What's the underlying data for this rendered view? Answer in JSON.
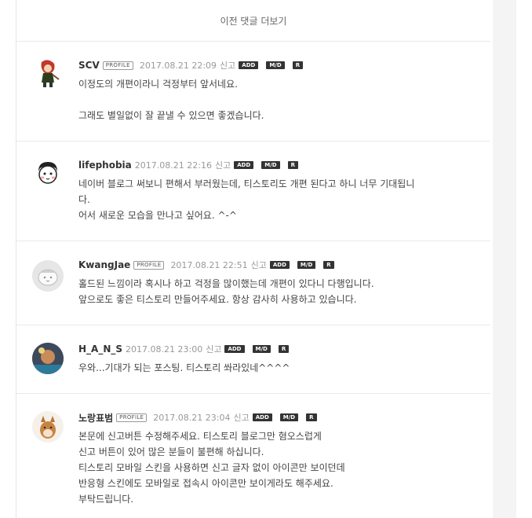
{
  "more_comments_label": "이전 댓글 더보기",
  "badges": {
    "profile": "PROFILE",
    "add": "ADD",
    "md": "M/D",
    "r": "R",
    "report": "신고"
  },
  "comments": [
    {
      "author": "SCV",
      "has_profile": true,
      "date": "2017.08.21 22:09",
      "lines": [
        "이정도의 개편이라니 걱정부터 앞서네요.",
        "",
        "그래도 별일없이 잘 끝낼 수 있으면 좋겠습니다."
      ]
    },
    {
      "author": "lifephobia",
      "has_profile": false,
      "date": "2017.08.21 22:16",
      "lines": [
        "네이버 블로그 써보니 편해서 부러웠는데, 티스토리도 개편 된다고 하니 너무 기대됩니",
        "다.",
        "어서 새로운 모습을 만나고 싶어요. ^-^"
      ]
    },
    {
      "author": "KwangJae",
      "has_profile": true,
      "date": "2017.08.21 22:51",
      "lines": [
        "홀드된 느낌이라 혹시나 하고 걱정을 많이했는데 개편이 있다니 다행입니다.",
        "앞으로도 좋은 티스토리 만들어주세요. 항상 감사히 사용하고 있습니다."
      ]
    },
    {
      "author": "H_A_N_S",
      "has_profile": false,
      "date": "2017.08.21 23:00",
      "lines": [
        "우와...기대가 되는 포스팅. 티스토리 쏴라있네^^^^"
      ]
    },
    {
      "author": "노랑표범",
      "has_profile": true,
      "date": "2017.08.21 23:04",
      "lines": [
        "본문에 신고버튼 수정해주세요. 티스토리 블로그만 혐오스럽게",
        "신고 버튼이 있어 많은 분들이 불편해 하십니다.",
        "티스토리 모바일 스킨을 사용하면 신고 글자 없이 아이콘만 보이던데",
        "반응형 스킨에도 모바일로 접속시 아이콘만 보이게라도 해주세요.",
        "부탁드립니다."
      ]
    }
  ]
}
